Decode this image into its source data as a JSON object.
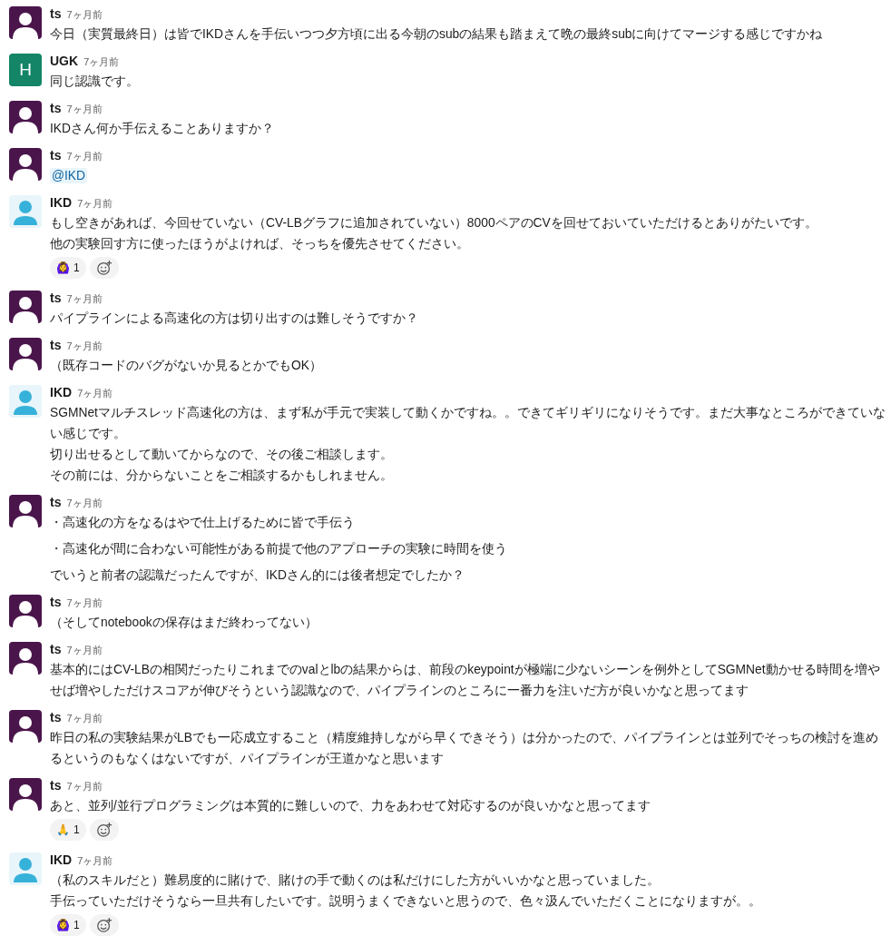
{
  "messages": [
    {
      "author": "ts",
      "avatar": {
        "kind": "silhouette-dark"
      },
      "time": "7ヶ月前",
      "lines": [
        "今日（実質最終日）は皆でIKDさんを手伝いつつ夕方頃に出る今朝のsubの結果も踏まえて晩の最終subに向けてマージする感じですかね"
      ]
    },
    {
      "author": "UGK",
      "avatar": {
        "kind": "letter",
        "letter": "H"
      },
      "time": "7ヶ月前",
      "lines": [
        "同じ認識です。"
      ]
    },
    {
      "author": "ts",
      "avatar": {
        "kind": "silhouette-dark"
      },
      "time": "7ヶ月前",
      "lines": [
        "IKDさん何か手伝えることありますか？"
      ]
    },
    {
      "author": "ts",
      "avatar": {
        "kind": "silhouette-dark"
      },
      "time": "7ヶ月前",
      "mention": "@IKD"
    },
    {
      "author": "IKD",
      "avatar": {
        "kind": "silhouette-light"
      },
      "time": "7ヶ月前",
      "lines": [
        "もし空きがあれば、今回せていない（CV-LBグラフに追加されていない）8000ペアのCVを回せておいていただけるとありがたいです。",
        "他の実験回す方に使ったほうがよければ、そっちを優先させてください。"
      ],
      "reactions": [
        {
          "emoji": "🙆‍♀️",
          "count": "1"
        }
      ]
    },
    {
      "author": "ts",
      "avatar": {
        "kind": "silhouette-dark"
      },
      "time": "7ヶ月前",
      "lines": [
        "パイプラインによる高速化の方は切り出すのは難しそうですか？"
      ]
    },
    {
      "author": "ts",
      "avatar": {
        "kind": "silhouette-dark"
      },
      "time": "7ヶ月前",
      "lines": [
        "（既存コードのバグがないか見るとかでもOK）"
      ]
    },
    {
      "author": "IKD",
      "avatar": {
        "kind": "silhouette-light"
      },
      "time": "7ヶ月前",
      "lines": [
        "SGMNetマルチスレッド高速化の方は、まず私が手元で実装して動くかですね。。できてギリギリになりそうです。まだ大事なところができていない感じです。",
        "切り出せるとして動いてからなので、その後ご相談します。",
        "その前には、分からないことをご相談するかもしれません。"
      ]
    },
    {
      "author": "ts",
      "avatar": {
        "kind": "silhouette-dark"
      },
      "time": "7ヶ月前",
      "spaced": true,
      "lines": [
        "・高速化の方をなるはやで仕上げるために皆で手伝う",
        "・高速化が間に合わない可能性がある前提で他のアプローチの実験に時間を使う",
        "でいうと前者の認識だったんですが、IKDさん的には後者想定でしたか？"
      ]
    },
    {
      "author": "ts",
      "avatar": {
        "kind": "silhouette-dark"
      },
      "time": "7ヶ月前",
      "lines": [
        "（そしてnotebookの保存はまだ終わってない）"
      ]
    },
    {
      "author": "ts",
      "avatar": {
        "kind": "silhouette-dark"
      },
      "time": "7ヶ月前",
      "lines": [
        "基本的にはCV-LBの相関だったりこれまでのvalとlbの結果からは、前段のkeypointが極端に少ないシーンを例外としてSGMNet動かせる時間を増やせば増やしただけスコアが伸びそうという認識なので、パイプラインのところに一番力を注いだ方が良いかなと思ってます"
      ]
    },
    {
      "author": "ts",
      "avatar": {
        "kind": "silhouette-dark"
      },
      "time": "7ヶ月前",
      "lines": [
        "昨日の私の実験結果がLBでも一応成立すること（精度維持しながら早くできそう）は分かったので、パイプラインとは並列でそっちの検討を進めるというのもなくはないですが、パイプラインが王道かなと思います"
      ]
    },
    {
      "author": "ts",
      "avatar": {
        "kind": "silhouette-dark"
      },
      "time": "7ヶ月前",
      "lines": [
        "あと、並列/並行プログラミングは本質的に難しいので、力をあわせて対応するのが良いかなと思ってます"
      ],
      "reactions": [
        {
          "emoji": "🙏",
          "count": "1"
        }
      ]
    },
    {
      "author": "IKD",
      "avatar": {
        "kind": "silhouette-light"
      },
      "time": "7ヶ月前",
      "lines": [
        "（私のスキルだと）難易度的に賭けで、賭けの手で動くのは私だけにした方がいいかなと思っていました。",
        "手伝っていただけそうなら一旦共有したいです。説明うまくできないと思うので、色々汲んでいただくことになりますが。。"
      ],
      "reactions": [
        {
          "emoji": "🙆‍♀️",
          "count": "1"
        }
      ]
    }
  ]
}
